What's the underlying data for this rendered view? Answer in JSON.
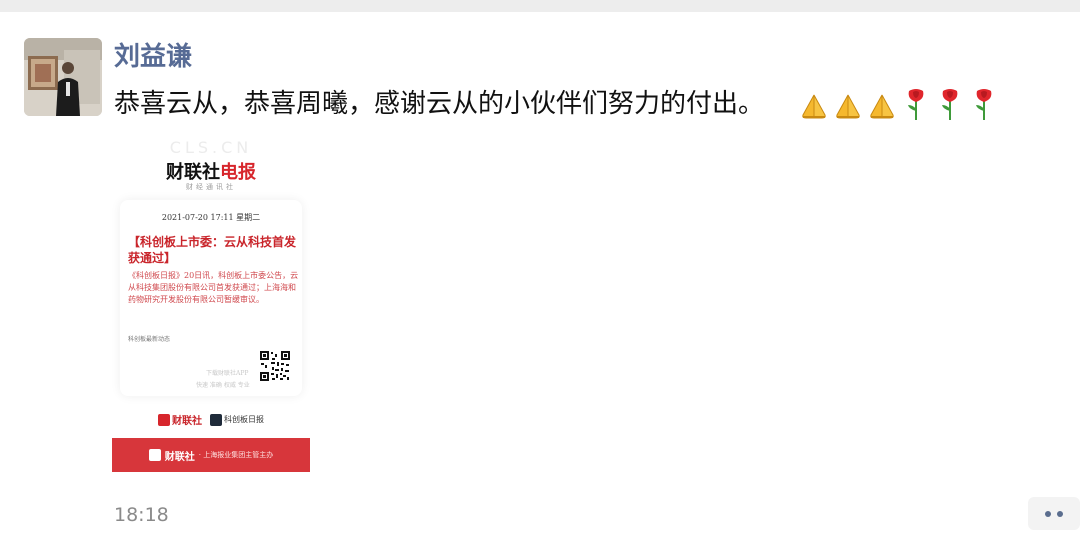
{
  "post": {
    "author": "刘益谦",
    "message": "恭喜云从，恭喜周曦，感谢云从的小伙伴们努力的付出。",
    "emojis": [
      "folded-hands",
      "folded-hands",
      "folded-hands",
      "rose",
      "rose",
      "rose"
    ],
    "time": "18:18"
  },
  "card": {
    "watermark": "CLS.CN",
    "logo_black": "财联社",
    "logo_red": "电报",
    "logo_sub": "财经通讯社",
    "date": "2021-07-20 17:11 星期二",
    "headline": "【科创板上市委：云从科技首发获通过】",
    "body": "《科创板日报》20日讯，科创板上市委公告，云从科技集团股份有限公司首发获通过；上海海和药物研究开发股份有限公司暂缓审议。",
    "tag": "科创板最新动态",
    "download_line1": "下载财联社APP",
    "download_line2": "快速 准确 权威 专业",
    "brand1": "财联社",
    "brand2": "科创板日报",
    "footer_logo": "财联社",
    "footer_text": "· 上海报业集团主管主办"
  },
  "colors": {
    "author_blue": "#576b95",
    "card_red": "#d7262c",
    "more_dots": "#5a6d8e"
  }
}
